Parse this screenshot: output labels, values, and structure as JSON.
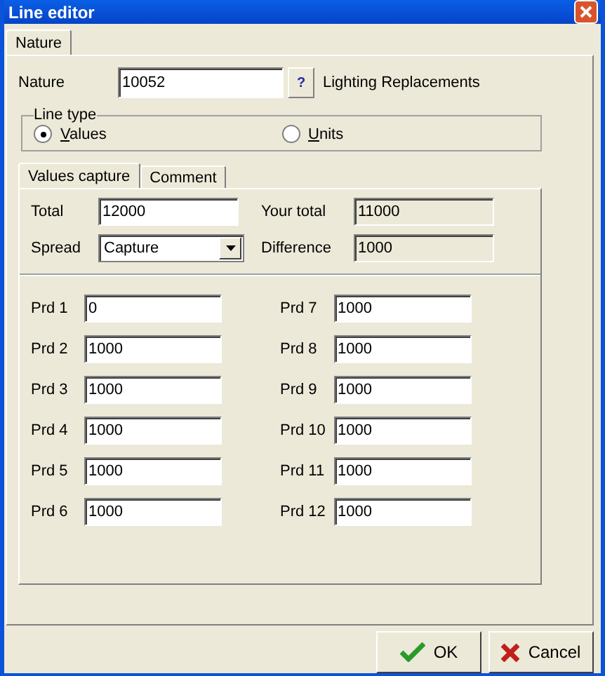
{
  "window": {
    "title": "Line editor"
  },
  "tabs": [
    {
      "label": "Nature",
      "selected": true
    }
  ],
  "nature": {
    "label": "Nature",
    "value": "10052",
    "lookup": "?",
    "description": "Lighting Replacements"
  },
  "line_type": {
    "title": "Line type",
    "options": [
      {
        "label": "Values",
        "selected": true
      },
      {
        "label": "Units",
        "selected": false
      }
    ]
  },
  "inner_tabs": [
    {
      "label": "Values capture",
      "selected": true
    },
    {
      "label": "Comment",
      "selected": false
    }
  ],
  "total": {
    "label": "Total",
    "value": "12000"
  },
  "your_total": {
    "label": "Your total",
    "value": "11000"
  },
  "spread": {
    "label": "Spread",
    "value": "Capture"
  },
  "difference": {
    "label": "Difference",
    "value": "1000"
  },
  "periods": [
    {
      "label": "Prd 1",
      "value": "0"
    },
    {
      "label": "Prd 2",
      "value": "1000"
    },
    {
      "label": "Prd 3",
      "value": "1000"
    },
    {
      "label": "Prd 4",
      "value": "1000"
    },
    {
      "label": "Prd 5",
      "value": "1000"
    },
    {
      "label": "Prd 6",
      "value": "1000"
    },
    {
      "label": "Prd 7",
      "value": "1000"
    },
    {
      "label": "Prd 8",
      "value": "1000"
    },
    {
      "label": "Prd 9",
      "value": "1000"
    },
    {
      "label": "Prd 10",
      "value": "1000"
    },
    {
      "label": "Prd 11",
      "value": "1000"
    },
    {
      "label": "Prd 12",
      "value": "1000"
    }
  ],
  "buttons": [
    {
      "label": "OK",
      "kind": "ok"
    },
    {
      "label": "Cancel",
      "kind": "cancel"
    }
  ]
}
